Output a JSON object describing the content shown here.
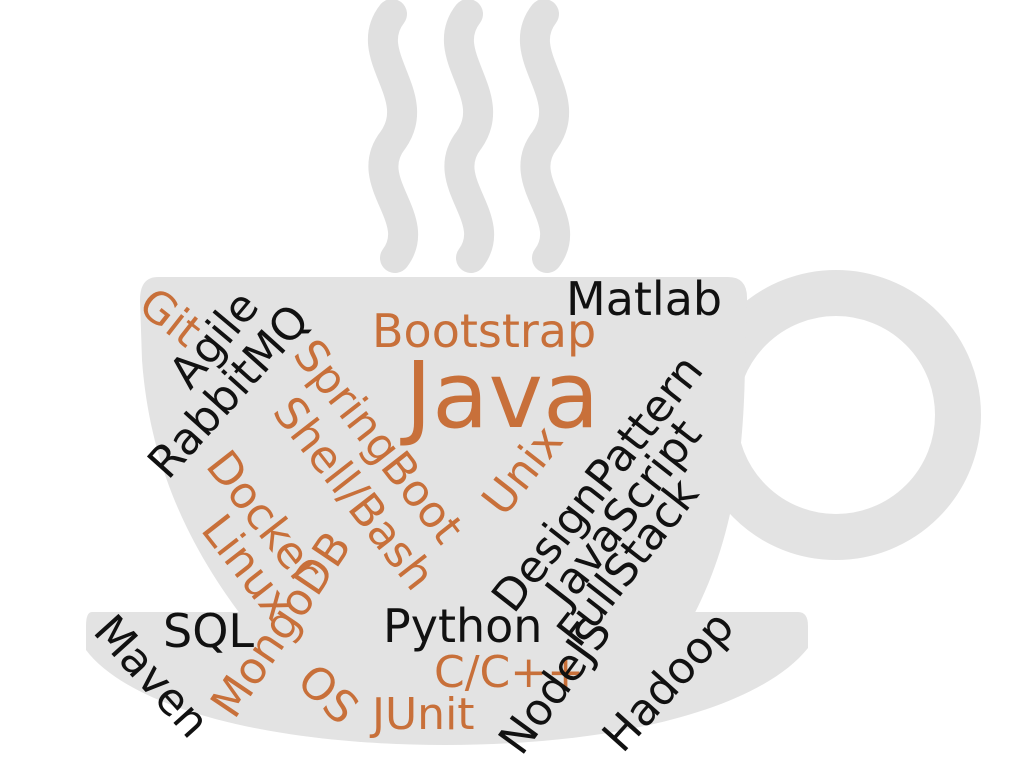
{
  "graphic": "coffee-cup-word-cloud",
  "colors": {
    "cup": "#e3e3e3",
    "steam": "#e0e0e0",
    "accent": "#c8703a",
    "text": "#111111",
    "background": "#ffffff"
  },
  "words": {
    "java": "Java",
    "bootstrap": "Bootstrap",
    "matlab": "Matlab",
    "git": "Git",
    "agile": "Agile",
    "rabbitmq": "RabbitMQ",
    "springboot": "SpringBoot",
    "shell_bash": "Shell/Bash",
    "docker": "Docker",
    "linux": "Linux",
    "mongodb": "MongoDB",
    "unix": "Unix",
    "designpattern": "DesignPattern",
    "javascript": "JavaScript",
    "fullstack": "FullStack",
    "sql": "SQL",
    "maven": "Maven",
    "python": "Python",
    "os": "OS",
    "cpp": "C/C++",
    "junit": "JUnit",
    "nodejs": "NodeJS",
    "hadoop": "Hadoop"
  }
}
